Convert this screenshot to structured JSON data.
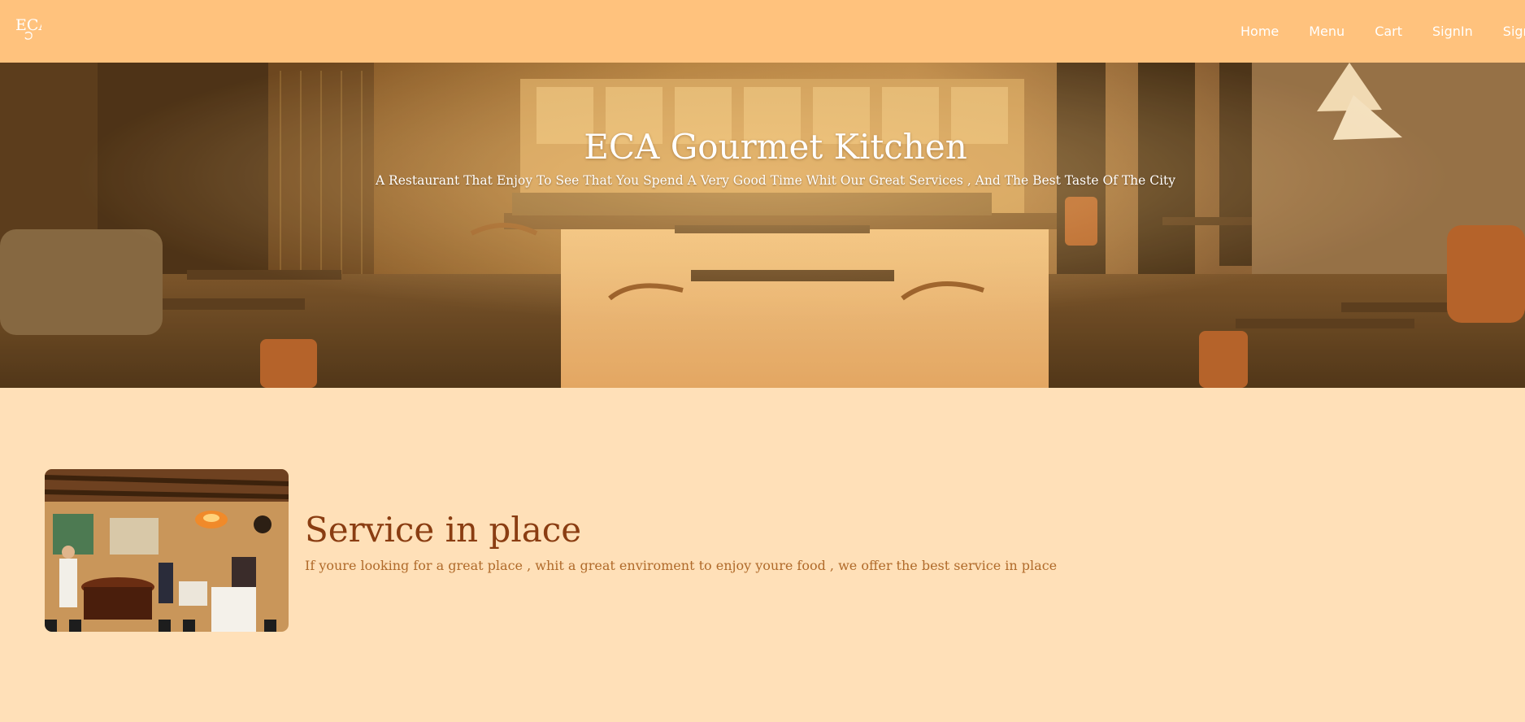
{
  "brand": {
    "logo_text": "ECA"
  },
  "nav": {
    "items": [
      {
        "label": "Home"
      },
      {
        "label": "Menu"
      },
      {
        "label": "Cart"
      },
      {
        "label": "SignIn"
      },
      {
        "label": "SignUp"
      }
    ]
  },
  "hero": {
    "title": "ECA Gourmet Kitchen",
    "subtitle": "A Restaurant That Enjoy To See That You Spend A Very Good Time Whit Our Great Services , And The Best Taste Of The City"
  },
  "service": {
    "title": "Service in place",
    "description": "If youre looking for a great place , whit a great enviroment to enjoy youre food , we offer the best service in place"
  },
  "colors": {
    "navbar_bg": "#ffc27d",
    "page_bg": "#ffe0b8",
    "heading": "#8a3d12",
    "body_text": "#b06a2a",
    "nav_text": "#ffffff"
  }
}
